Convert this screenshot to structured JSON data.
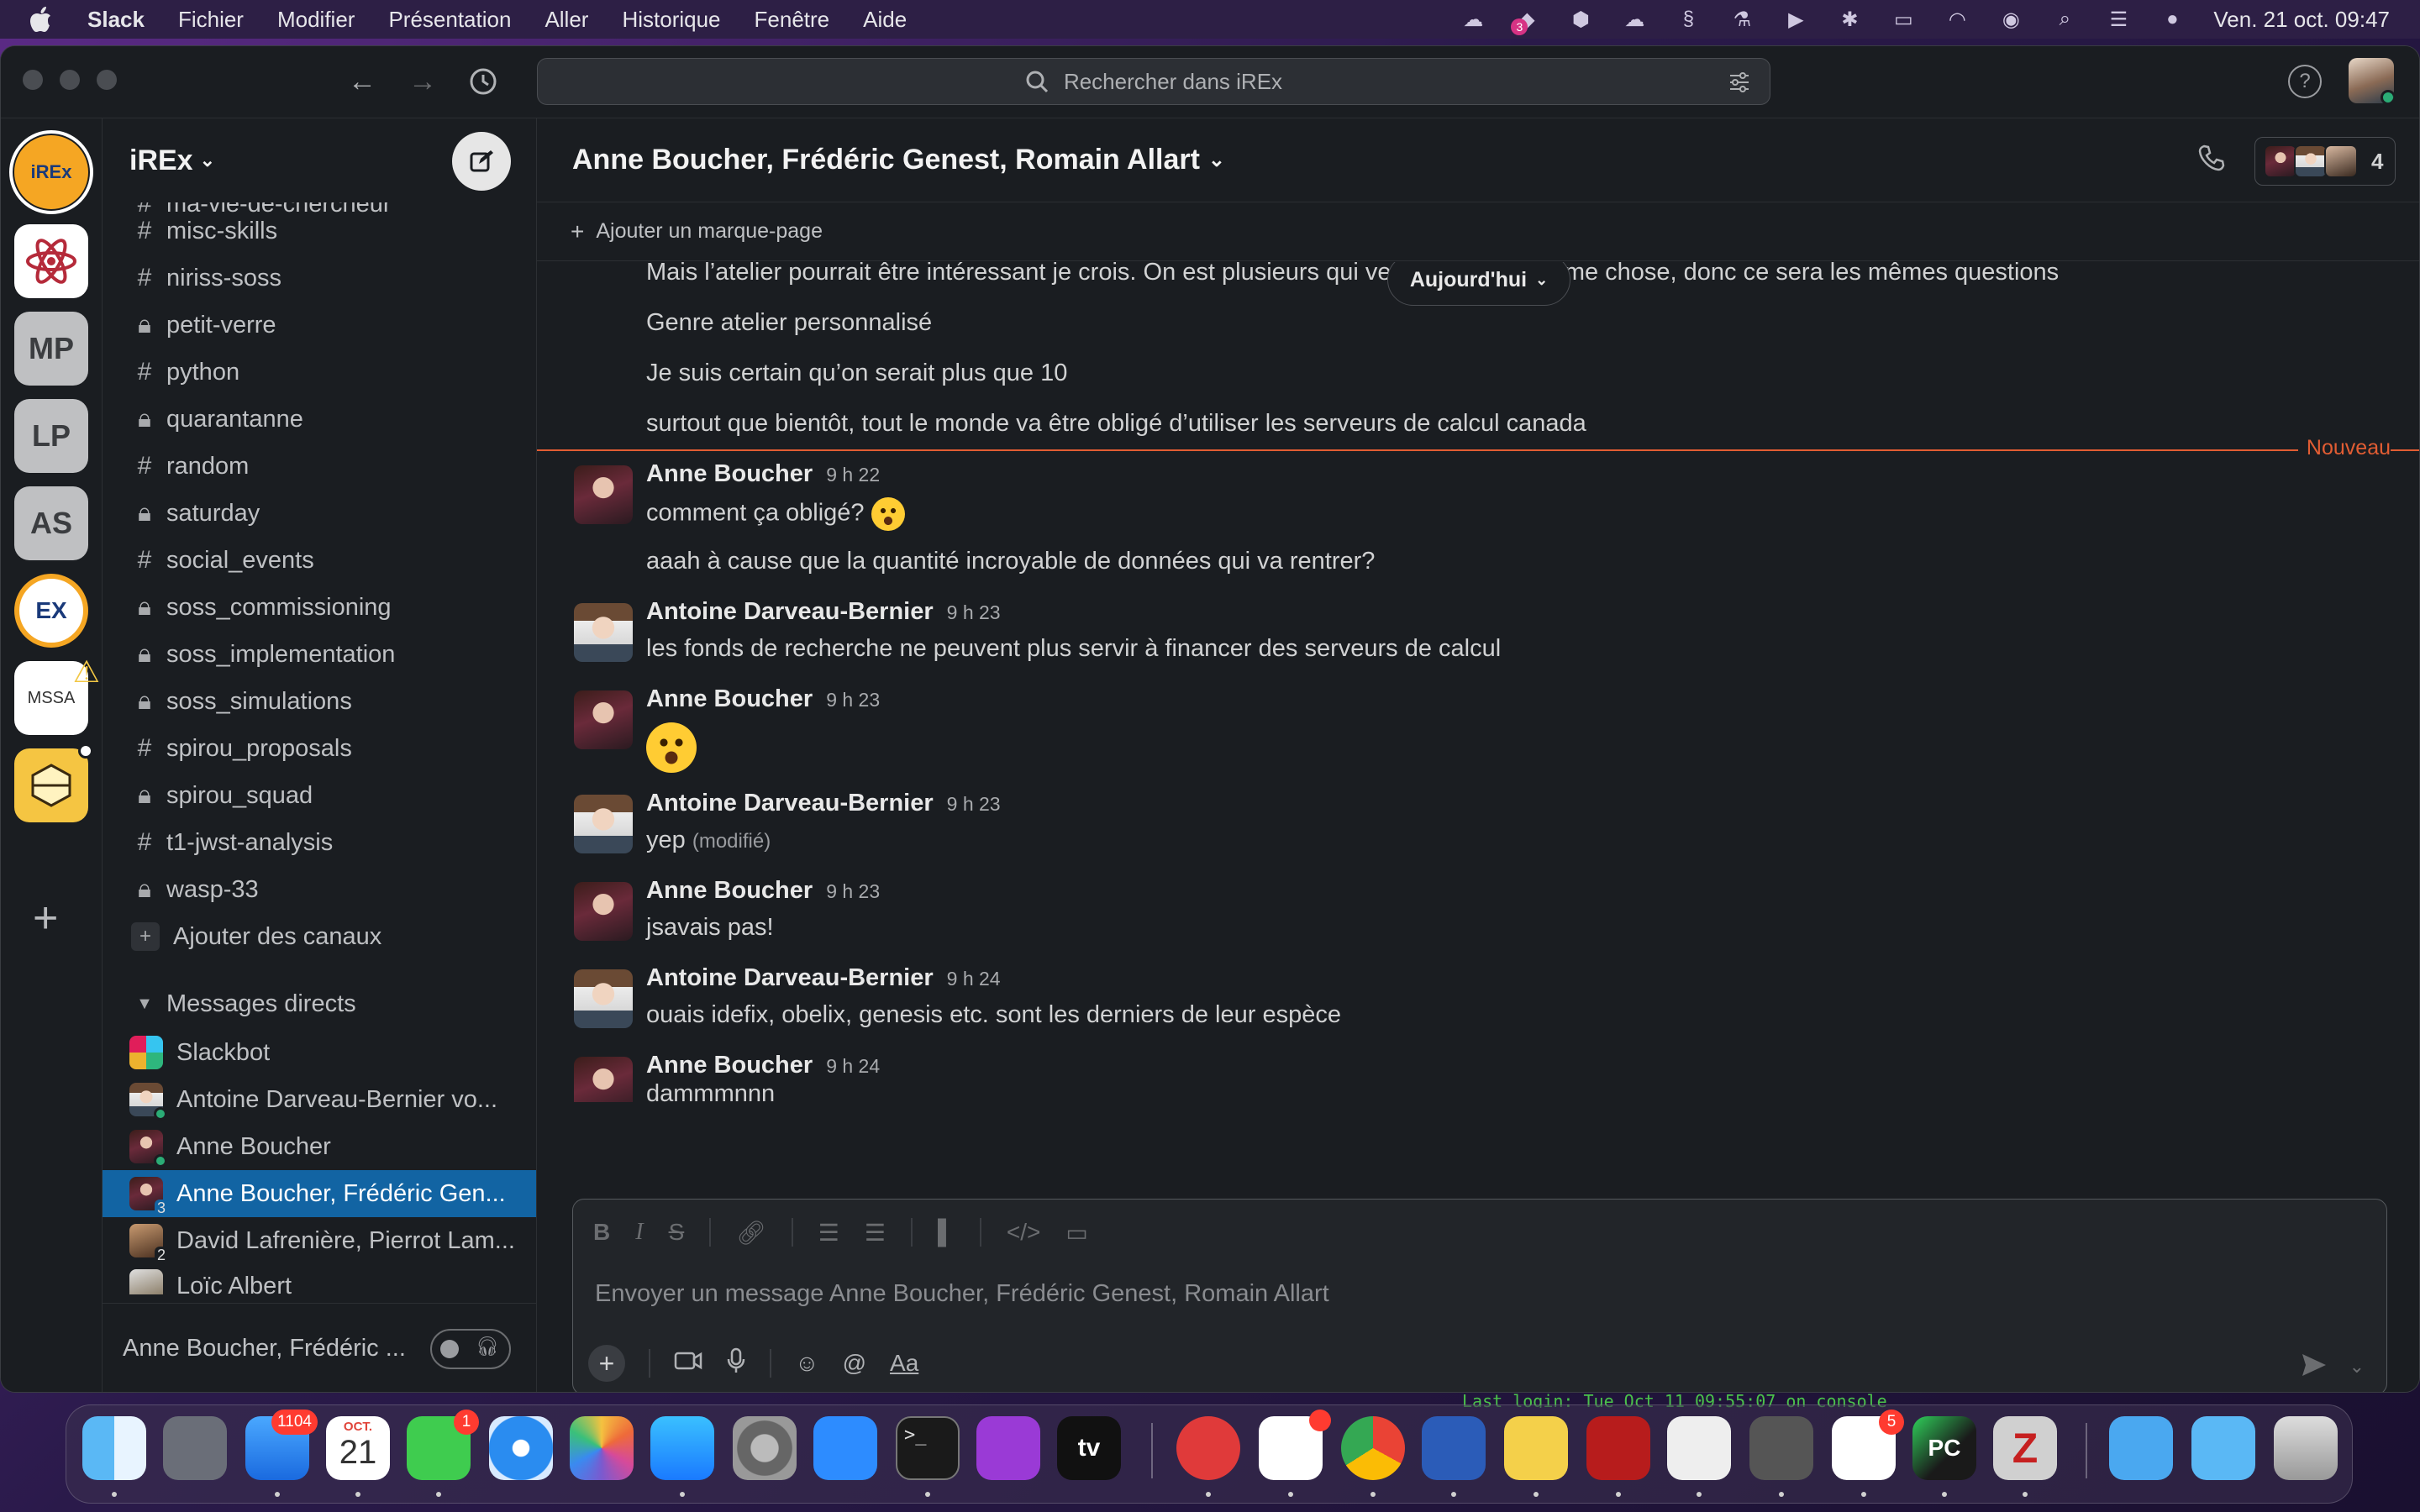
{
  "menubar": {
    "app": "Slack",
    "items": [
      "Fichier",
      "Modifier",
      "Présentation",
      "Aller",
      "Historique",
      "Fenêtre",
      "Aide"
    ],
    "datetime": "Ven. 21 oct. 09:47",
    "dropbox_badge": "3"
  },
  "search": {
    "placeholder": "Rechercher dans iREx"
  },
  "workspaces": [
    {
      "label": "iREx"
    },
    {
      "label": ""
    },
    {
      "label": "MP"
    },
    {
      "label": "LP"
    },
    {
      "label": "AS"
    },
    {
      "label": "EX"
    },
    {
      "label": "MSSA"
    },
    {
      "label": ""
    }
  ],
  "sidebar": {
    "workspace_name": "iREx",
    "channels": [
      {
        "name": "ma-vie-de-chercheur",
        "type": "#"
      },
      {
        "name": "misc-skills",
        "type": "#"
      },
      {
        "name": "niriss-soss",
        "type": "#"
      },
      {
        "name": "petit-verre",
        "type": "lock"
      },
      {
        "name": "python",
        "type": "#"
      },
      {
        "name": "quarantanne",
        "type": "lock"
      },
      {
        "name": "random",
        "type": "#"
      },
      {
        "name": "saturday",
        "type": "lock"
      },
      {
        "name": "social_events",
        "type": "#"
      },
      {
        "name": "soss_commissioning",
        "type": "lock"
      },
      {
        "name": "soss_implementation",
        "type": "lock"
      },
      {
        "name": "soss_simulations",
        "type": "lock"
      },
      {
        "name": "spirou_proposals",
        "type": "#"
      },
      {
        "name": "spirou_squad",
        "type": "lock"
      },
      {
        "name": "t1-jwst-analysis",
        "type": "#"
      },
      {
        "name": "wasp-33",
        "type": "lock"
      }
    ],
    "add_channels": "Ajouter des canaux",
    "dm_section": "Messages directs",
    "dms": [
      {
        "name": "Slackbot"
      },
      {
        "name": "Antoine Darveau-Bernier  vo..."
      },
      {
        "name": "Anne Boucher"
      },
      {
        "name": "Anne Boucher, Frédéric Gen...",
        "count": "3"
      },
      {
        "name": "David Lafrenière, Pierrot Lam...",
        "count": "2"
      },
      {
        "name": "Loïc Albert"
      }
    ],
    "footer": "Anne Boucher, Frédéric ..."
  },
  "channel": {
    "title": "Anne Boucher, Frédéric Genest, Romain Allart",
    "member_count": "4",
    "bookmark": "Ajouter un marque-page",
    "day_divider": "Aujourd'hui",
    "new_label": "Nouveau"
  },
  "messages": {
    "earlier": [
      "Mais l’atelier pourrait être intéressant je crois. On est plusieurs qui veulent faire la même chose, donc ce sera les mêmes questions",
      "Genre atelier personnalisé",
      "Je suis certain qu’on serait plus que 10",
      "surtout que bientôt, tout le monde va être obligé d’utiliser les serveurs de calcul canada"
    ],
    "m1": {
      "author": "Anne Boucher",
      "time": "9 h 22",
      "text": "comment ça obligé?",
      "text2": "aaah à cause que la quantité incroyable de données qui va rentrer?"
    },
    "m2": {
      "author": "Antoine Darveau-Bernier",
      "time": "9 h 23",
      "text": "les fonds de recherche ne peuvent plus servir à financer des serveurs de calcul"
    },
    "m3": {
      "author": "Anne Boucher",
      "time": "9 h 23"
    },
    "m4": {
      "author": "Antoine Darveau-Bernier",
      "time": "9 h 23",
      "text": "yep",
      "edited": "(modifié)"
    },
    "m5": {
      "author": "Anne Boucher",
      "time": "9 h 23",
      "text": "jsavais pas!"
    },
    "m6": {
      "author": "Antoine Darveau-Bernier",
      "time": "9 h 24",
      "text": "ouais idefix, obelix, genesis etc. sont les derniers de leur espèce"
    },
    "m7": {
      "author": "Anne Boucher",
      "time": "9 h 24",
      "text": "dammmnnn"
    }
  },
  "composer": {
    "placeholder": "Envoyer un message Anne Boucher, Frédéric Genest, Romain Allart",
    "format_label": "Aa"
  },
  "dock": {
    "mail_badge": "1104",
    "calendar_month": "OCT.",
    "calendar_day": "21",
    "messages_badge": "1",
    "tv_label": "tv",
    "reminders_badge": "5",
    "pycharm_label": "PC",
    "terminal_text": "Last login: Tue Oct 11 09:55:07 on console"
  }
}
